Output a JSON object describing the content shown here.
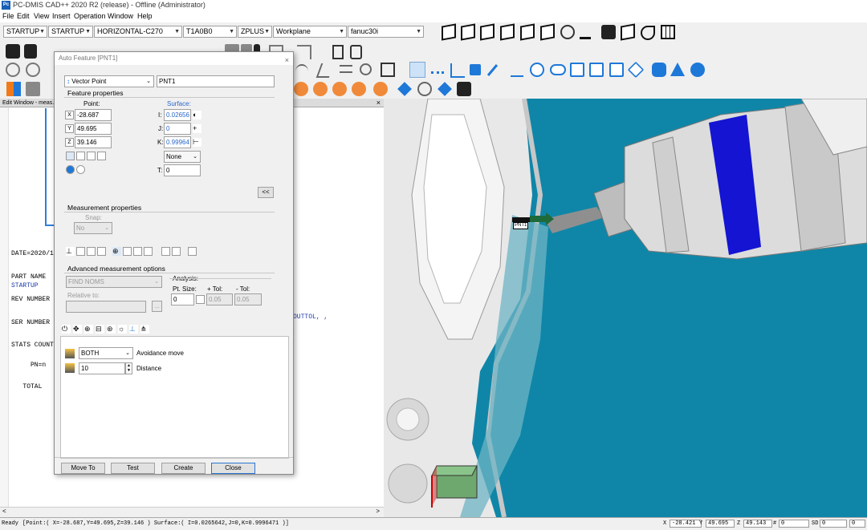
{
  "window": {
    "app_icon": "Pc",
    "title": "PC-DMIS CAD++ 2020 R2 (release) - Offline (Administrator)"
  },
  "menu": [
    "File",
    "Edit",
    "View",
    "Insert",
    "Operation",
    "Window",
    "Help"
  ],
  "toolbar": {
    "combos": [
      "STARTUP",
      "STARTUP",
      "HORIZONTAL-C270",
      "T1A0B0",
      "ZPLUS",
      "Workplane",
      "fanuc30i"
    ]
  },
  "edit_window": {
    "title": "Edit Window - meas.P",
    "close_label": "×",
    "lines": [
      "DATE=2020/1",
      "PART NAME",
      "REV NUMBER",
      "SER NUMBER",
      "STATS COUNT"
    ],
    "startup": "STARTUP",
    "continuation": "OUTTOL, ,",
    "pn_lines": [
      "     PN=n",
      "   TOTAL"
    ],
    "scroll_left": "<",
    "scroll_right": ">"
  },
  "dialog": {
    "title": "Auto Feature [PNT1]",
    "close_label": "×",
    "feature_type": "Vector Point",
    "feature_name": "PNT1",
    "feature_properties_label": "Feature properties",
    "point_label": "Point:",
    "surface_label": "Surface:",
    "x_label": "X",
    "x_value": "-28.687",
    "y_label": "Y",
    "y_value": "49.695",
    "z_label": "Z",
    "z_value": "39.146",
    "i_label": "I:",
    "i_value": "0.02656",
    "j_label": "J:",
    "j_value": "0",
    "k_label": "K:",
    "k_value": "0.99964",
    "none_select": "None",
    "t_label": "T:",
    "t_value": "0",
    "collapse_label": "<<",
    "measurement_properties_label": "Measurement properties",
    "snap_label": "Snap:",
    "snap_value": "No",
    "advanced_label": "Advanced measurement options",
    "find_noms": "FIND NOMS",
    "relative_to_label": "Relative to:",
    "relative_browse": "...",
    "analysis_label": "Analysis:",
    "pt_size_label": "Pt. Size:",
    "plus_tol_label": "+ Tol:",
    "minus_tol_label": "- Tol:",
    "pt_size_value": "0",
    "plus_tol_value": "0.05",
    "minus_tol_value": "0.05",
    "avoidance_value": "BOTH",
    "avoidance_label": "Avoidance move",
    "distance_value": "10",
    "distance_label": "Distance",
    "buttons": {
      "move_to": "Move To",
      "test": "Test",
      "create": "Create",
      "close": "Close"
    }
  },
  "graphics": {
    "feature_tag": "PNT1"
  },
  "status": {
    "ready": "Ready",
    "info": "[Point:( X=-28.687,Y=49.695,Z=39.146 )  Surface:( I=0.0265642,J=0,K=0.9996471 )]",
    "x_label": "X",
    "x_value": "-28.421",
    "y_label": "Y",
    "y_value": "49.695",
    "z_label": "Z",
    "z_value": "49.143",
    "hash_label": "#",
    "hash_value": "0",
    "sd_label": "SD",
    "sd_value": "0",
    "last_value": "0"
  },
  "colors": {
    "viewport_bg": "#0f86a8",
    "toolbar_accent": "#1e78d8",
    "spindle_band": "#1414d2",
    "part_gray": "#e6e6e6"
  }
}
